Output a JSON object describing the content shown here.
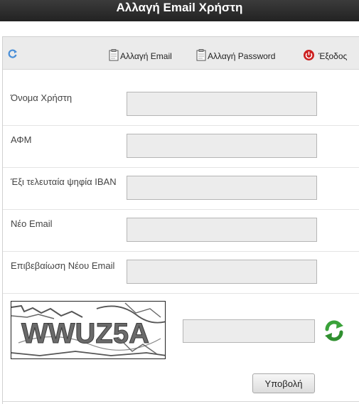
{
  "header": {
    "title": "Αλλαγή Email Χρήστη"
  },
  "toolbar": {
    "change_email": "Αλλαγή Email",
    "change_password": "Αλλαγή Password",
    "logout": "Έξοδος"
  },
  "form": {
    "fields": [
      {
        "label": "Όνομα Χρήστη",
        "value": ""
      },
      {
        "label": "ΑΦΜ",
        "value": ""
      },
      {
        "label": "Έξι τελευταία ψηφία IBAN",
        "value": ""
      },
      {
        "label": "Νέο Email",
        "value": ""
      },
      {
        "label": "Επιβεβαίωση Νέου Email",
        "value": ""
      }
    ],
    "captcha": {
      "text": "WWUZ5A",
      "input_value": ""
    },
    "submit_label": "Υποβολή"
  },
  "colors": {
    "header_bg": "#2e2e2e",
    "toolbar_bg": "#ebebeb",
    "field_bg": "#ececec",
    "logout_icon": "#cc1f1f",
    "refresh_icon": "#3aa23a",
    "small_refresh_icon": "#4a8fd8"
  }
}
